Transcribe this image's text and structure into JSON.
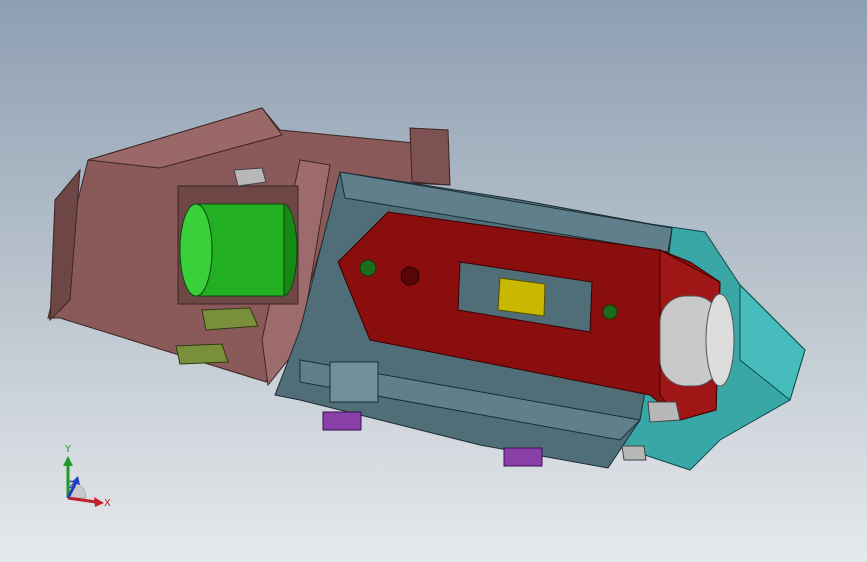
{
  "viewport": {
    "background_top": "#8e9fb3",
    "background_bottom": "#e6e9ec"
  },
  "model": {
    "colors": {
      "housing": "#8a5a5a",
      "housing_dark": "#6e4646",
      "roller": "#22b022",
      "frame": "#4f6e78",
      "plate": "#8b0e0e",
      "guide": "#3aa7a7",
      "insert": "#c9b800",
      "wheel": "#c9c9c9",
      "hardware": "#b8b8b8",
      "bracket": "#7a8f3a",
      "spacer": "#8a3fa8"
    }
  },
  "triad": {
    "x_label": "X",
    "y_label": "Y",
    "z_label": "Z",
    "x_color": "#c0202a",
    "y_color": "#1f9a2a",
    "z_color": "#1e3cc4"
  }
}
